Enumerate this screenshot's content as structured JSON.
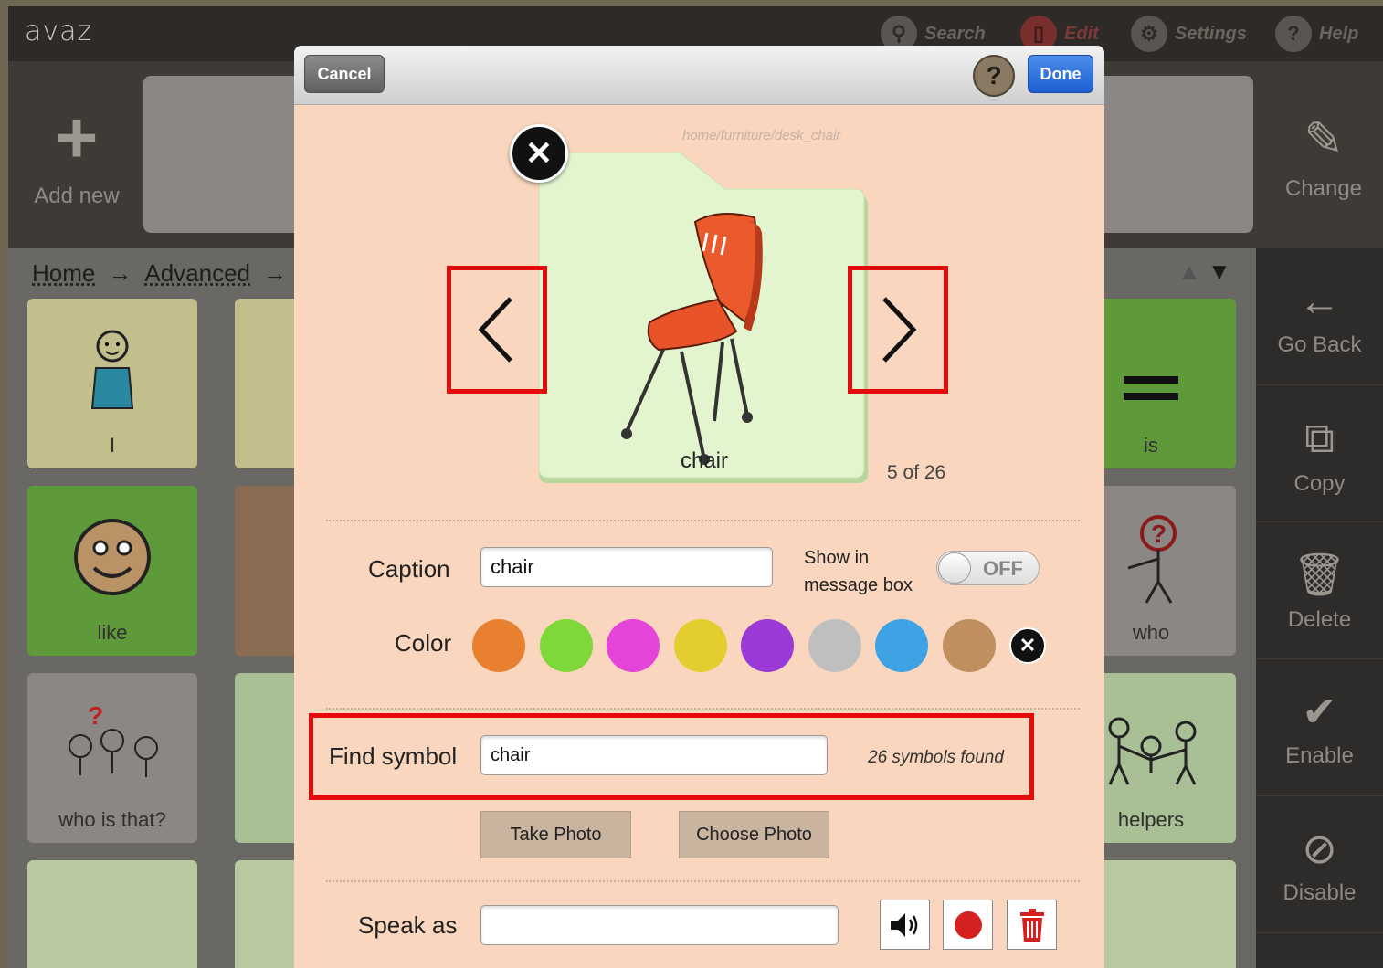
{
  "app": {
    "logo": "avaz"
  },
  "topnav": {
    "search": {
      "label": "Search",
      "icon": "search-icon"
    },
    "edit": {
      "label": "Edit",
      "icon": "edit-icon"
    },
    "settings": {
      "label": "Settings",
      "icon": "gear-icon"
    },
    "help": {
      "label": "Help",
      "icon": "help-icon"
    }
  },
  "strip": {
    "add_new": "Add new",
    "change": "Change"
  },
  "breadcrumb": [
    "Home",
    "Advanced"
  ],
  "tiles": [
    {
      "caption": "I",
      "icon": "person-icon"
    },
    {
      "caption": "like",
      "icon": "smiley-icon"
    },
    {
      "caption": "who is that?",
      "icon": "people-question-icon"
    },
    {
      "caption": "is",
      "icon": "equals-icon"
    },
    {
      "caption": "who",
      "icon": "person-question-icon"
    },
    {
      "caption": "helpers",
      "icon": "helpers-icon"
    }
  ],
  "sidebar": [
    "Go Back",
    "Copy",
    "Delete",
    "Enable",
    "Disable"
  ],
  "modal": {
    "cancel": "Cancel",
    "help": "?",
    "done": "Done",
    "symbol_path": "home/furniture/desk_chair",
    "card_label": "chair",
    "counter": "5 of 26",
    "caption_label": "Caption",
    "caption_value": "chair",
    "show_in_label_1": "Show in",
    "show_in_label_2": "message box",
    "toggle_state": "OFF",
    "color_label": "Color",
    "colors": [
      "#e8802f",
      "#7fd83a",
      "#e444d8",
      "#e4cd2e",
      "#9a39d6",
      "#bfbfbf",
      "#3ea3e4",
      "#c08f5f"
    ],
    "find_label": "Find symbol",
    "find_value": "chair",
    "found_text": "26 symbols found",
    "take_photo": "Take Photo",
    "choose_photo": "Choose Photo",
    "speak_label": "Speak as",
    "speak_value": ""
  }
}
